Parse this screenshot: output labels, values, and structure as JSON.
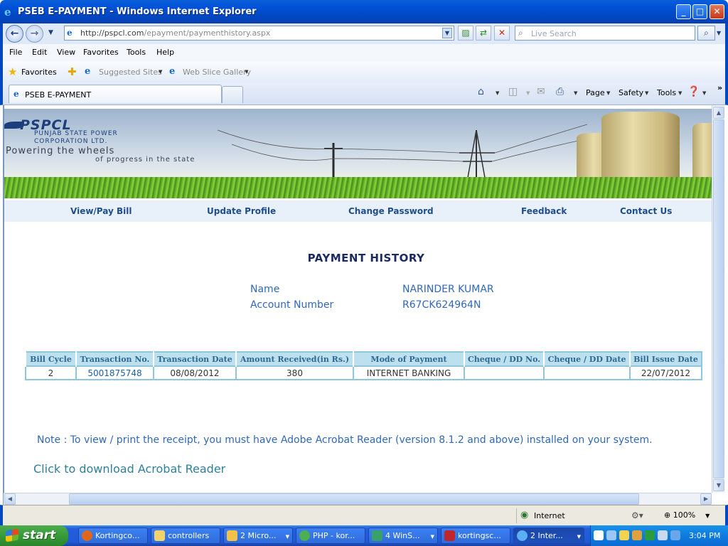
{
  "window": {
    "title": "PSEB E-PAYMENT - Windows Internet Explorer",
    "minimize": "_",
    "maximize": "□",
    "close": "✕"
  },
  "address": {
    "url_host": "http://pspcl.com",
    "url_path": "/epayment/paymenthistory.aspx",
    "search_placeholder": "Live Search"
  },
  "menu": [
    "File",
    "Edit",
    "View",
    "Favorites",
    "Tools",
    "Help"
  ],
  "favorites": {
    "label": "Favorites",
    "suggested": "Suggested Sites",
    "webslice": "Web Slice Gallery"
  },
  "tab": {
    "label": "PSEB E-PAYMENT"
  },
  "commands": {
    "page": "Page",
    "safety": "Safety",
    "tools": "Tools"
  },
  "banner": {
    "logo": "PSPCL",
    "company_line1": "PUNJAB STATE POWER",
    "company_line2": "CORPORATION LTD.",
    "tagline1": "Powering the wheels",
    "tagline2": "of progress in the state"
  },
  "nav": [
    "View/Pay Bill",
    "Update Profile",
    "Change Password",
    "Feedback",
    "Contact Us"
  ],
  "page": {
    "heading": "PAYMENT HISTORY",
    "name_label": "Name",
    "name_value": "NARINDER KUMAR",
    "account_label": "Account Number",
    "account_value": "R67CK624964N"
  },
  "table": {
    "headers": [
      "Bill Cycle",
      "Transaction No.",
      "Transaction Date",
      "Amount Received(in Rs.)",
      "Mode of Payment",
      "Cheque / DD No.",
      "Cheque / DD Date",
      "Bill Issue Date"
    ],
    "rows": [
      [
        "2",
        "5001875748",
        "08/08/2012",
        "380",
        "INTERNET BANKING",
        "",
        "",
        "22/07/2012"
      ]
    ]
  },
  "note": "Note : To view / print the receipt, you must have Adobe Acrobat Reader (version 8.1.2 and above) installed on your system.",
  "download_link": "Click to download Acrobat Reader",
  "status": {
    "zone": "Internet",
    "zoom": "100%"
  },
  "taskbar": {
    "start": "start",
    "tasks": [
      "Kortingco...",
      "controllers",
      "2 Micro...",
      "PHP - kor...",
      "4 WinS...",
      "kortingsc...",
      "2 Inter..."
    ],
    "clock": "3:04 PM"
  }
}
